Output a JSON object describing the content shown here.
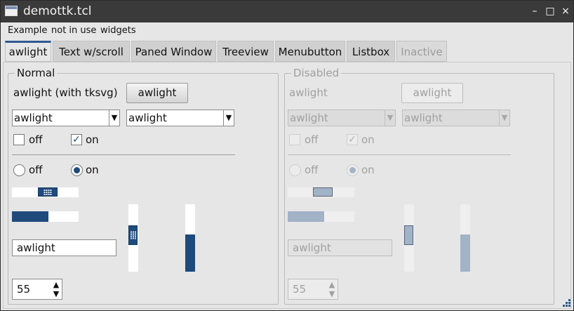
{
  "window": {
    "title": "demottk.tcl",
    "controls": [
      "–",
      "□",
      "×"
    ]
  },
  "menubar": {
    "items": [
      "Example",
      "not in use",
      "widgets"
    ]
  },
  "tabs": [
    {
      "label": "awlight",
      "state": "active"
    },
    {
      "label": "Text w/scroll",
      "state": "normal"
    },
    {
      "label": "Paned Window",
      "state": "normal"
    },
    {
      "label": "Treeview",
      "state": "normal"
    },
    {
      "label": "Menubutton",
      "state": "normal"
    },
    {
      "label": "Listbox",
      "state": "normal"
    },
    {
      "label": "Inactive",
      "state": "disabled"
    }
  ],
  "normal": {
    "title": "Normal",
    "label": "awlight (with tksvg)",
    "button": "awlight",
    "combo1": "awlight",
    "combo2": "awlight",
    "check_off": "off",
    "check_on": "on",
    "radio_off": "off",
    "radio_on": "on",
    "entry": "awlight",
    "spin": "55",
    "progress_fraction": 0.55
  },
  "disabled": {
    "title": "Disabled",
    "label": "awlight",
    "button": "awlight",
    "combo1": "awlight",
    "combo2": "awlight",
    "check_off": "off",
    "check_on": "on",
    "radio_off": "off",
    "radio_on": "on",
    "entry": "awlight",
    "spin": "55",
    "progress_fraction": 0.55
  },
  "icons": {
    "check_mark": "✓",
    "combo_arrow": "▼",
    "spin_up": "▲",
    "spin_down": "▼"
  },
  "colors": {
    "accent": "#1f4a7c",
    "titlebar": "#3a3a3a",
    "background": "#e6e6e6"
  }
}
